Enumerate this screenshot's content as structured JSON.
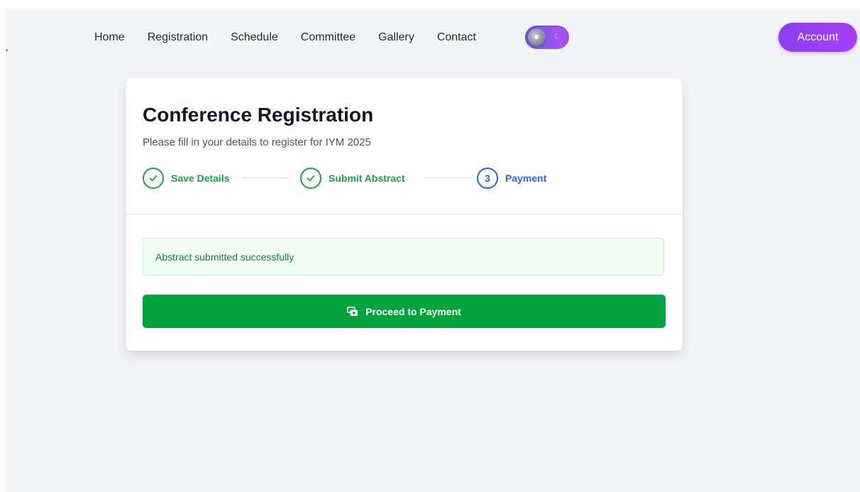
{
  "nav": {
    "links": [
      "Home",
      "Registration",
      "Schedule",
      "Committee",
      "Gallery",
      "Contact"
    ],
    "account_label": "Account",
    "theme_toggle_state": "dark"
  },
  "card": {
    "title": "Conference Registration",
    "subtitle": "Please fill in your details to register for IYM 2025",
    "steps": [
      {
        "label": "Save Details",
        "status": "done",
        "icon": "check-icon"
      },
      {
        "label": "Submit Abstract",
        "status": "done",
        "icon": "check-icon"
      },
      {
        "label": "Payment",
        "status": "active",
        "number": "3"
      }
    ],
    "alert": {
      "text": "Abstract submitted successfully"
    },
    "payment_button": {
      "label": "Proceed to Payment",
      "icon": "money-icon"
    }
  },
  "colors": {
    "primary_green": "#02a23d",
    "step_done": "#16a34a",
    "step_active": "#2563eb",
    "account_purple": "#8b3ff0",
    "alert_bg": "#f0fdf4"
  }
}
